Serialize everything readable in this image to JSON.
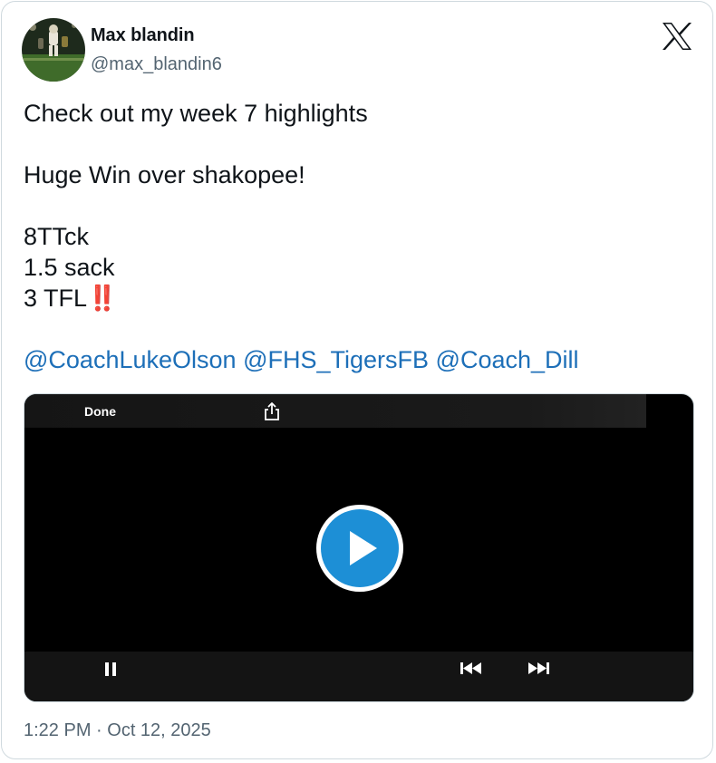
{
  "author": {
    "display_name": "Max blandin",
    "handle": "@max_blandin6"
  },
  "tweet": {
    "lines": [
      "Check out my week 7 highlights",
      "",
      "Huge Win over shakopee!",
      "",
      "8TTck",
      "1.5 sack",
      "3 TFL"
    ],
    "emoji": "‼️",
    "mentions": [
      "@CoachLukeOlson",
      "@FHS_TigersFB",
      "@Coach_Dill"
    ],
    "timestamp": "1:22 PM · Oct 12, 2025"
  },
  "player": {
    "done_label": "Done"
  },
  "icons": {
    "logo": "x-logo-icon",
    "share": "share-icon",
    "play": "play-icon",
    "pause": "pause-icon",
    "rewind": "rewind-icon",
    "fast_forward": "fast-forward-icon"
  },
  "colors": {
    "link": "#1d6fb8",
    "muted": "#536471",
    "play_accent": "#1d8fd6",
    "emoji_red": "#d6262f"
  }
}
